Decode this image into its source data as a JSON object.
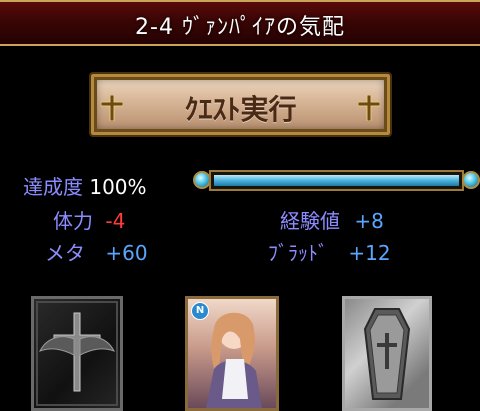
{
  "header": {
    "title": "2-4 ｳﾞｧﾝﾊﾟｲｱの気配"
  },
  "quest_button": {
    "label": "ｸｴｽﾄ実行"
  },
  "stats": {
    "achievement": {
      "label": "達成度",
      "value": "100%"
    },
    "stamina": {
      "label": "体力",
      "value": "-4"
    },
    "exp": {
      "label": "経験値",
      "value": "+8"
    },
    "meta": {
      "label": "メタ",
      "value": "+60"
    },
    "blood": {
      "label": "ﾌﾞﾗｯﾄﾞ",
      "value": "+12"
    }
  },
  "progress": {
    "fraction": 1.0
  },
  "cards": {
    "chara_badge": "N",
    "items": [
      {
        "kind": "card-back",
        "icon": "winged-cross-icon"
      },
      {
        "kind": "character-card",
        "icon": "character-portrait-icon"
      },
      {
        "kind": "coffin-card",
        "icon": "coffin-icon"
      }
    ]
  },
  "colors": {
    "label_purple": "#8c8cff",
    "negative_red": "#ff3b3b",
    "positive_blue": "#5aa6ff",
    "gold_frame": "#b48a3c"
  }
}
